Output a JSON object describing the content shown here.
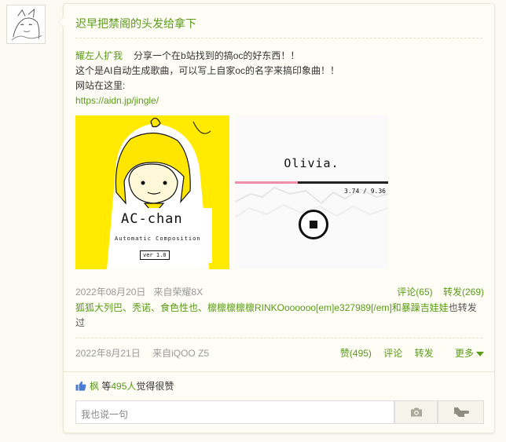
{
  "post": {
    "author": "迟早把禁阁的头发给拿下",
    "retweet": {
      "user": "耀左人扩我",
      "lead_text": "分享一个在b站找到的搞oc的好东西！！",
      "line2": "这个是AI自动生成歌曲，可以写上自家oc的名字来搞印象曲！！",
      "line3": "网站在这里:",
      "link": "https://aidn.jp/jingle/",
      "media": {
        "left_title": "AC-chan",
        "left_subtitle": "Automatic Composition",
        "left_version": "ver 1.0",
        "right_name": "Olivia.",
        "right_time": "3.74 / 9.36"
      },
      "date": "2022年08月20日",
      "source": "来自荣耀8X",
      "comments": "评论(65)",
      "reposts": "转发(269)",
      "chain_green": "狐狐大列巴、秃诺、食色性也、檩檩檩檩檩RINKOoooooo[em]e327989[/em]和暴躁吉娃娃",
      "chain_grey": "也转发过"
    },
    "date": "2022年8月21日",
    "source": "来自iQOO Z5",
    "actions": {
      "like": "赞(495)",
      "comment": "评论",
      "repost": "转发",
      "more": "更多"
    },
    "likes": {
      "user": "枫",
      "middle": "等",
      "count": "495人",
      "tail": "觉得很赞"
    },
    "comment_placeholder": "我也说一句"
  },
  "colors": {
    "accent": "#5a9a17",
    "background": "#fbfbf3",
    "ac_yellow": "#ffea00",
    "progress_pink": "#ef90a8"
  },
  "icons": [
    "avatar-sketch",
    "thumbs-up-icon",
    "camera-icon",
    "send-icon",
    "chevron-down-icon",
    "stop-icon"
  ]
}
